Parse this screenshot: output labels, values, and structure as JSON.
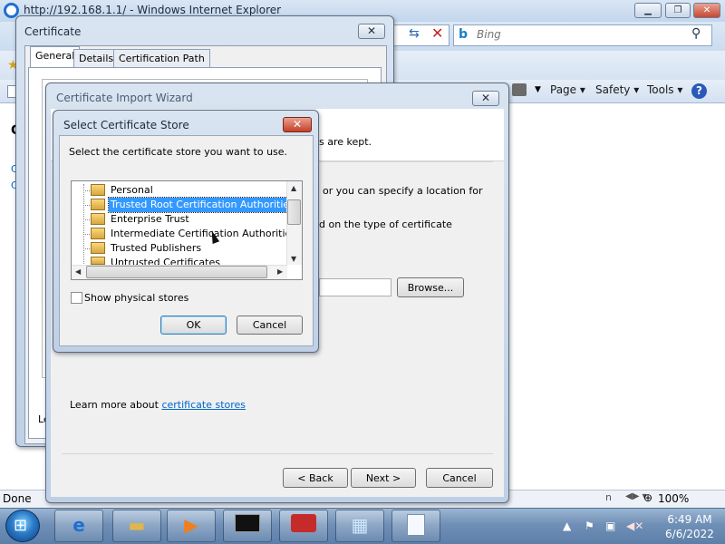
{
  "ie": {
    "title": "http://192.168.1.1/ - Windows Internet Explorer",
    "search_placeholder": "Bing",
    "commands": [
      "Page ▾",
      "Safety ▾",
      "Tools ▾"
    ],
    "status": "Done",
    "zoom": "100%"
  },
  "cert": {
    "title": "Certificate",
    "tabs": [
      "General",
      "Details",
      "Certification Path"
    ],
    "fragment": "Le"
  },
  "wizard": {
    "title": "Certificate Import Wizard",
    "line1": "s are kept.",
    "line2": "or you can specify a location for",
    "line3": "d on the type of certificate",
    "browse": "Browse...",
    "learn_prefix": "Learn more about ",
    "learn_link": "certificate stores",
    "back": "< Back",
    "next": "Next >",
    "cancel": "Cancel"
  },
  "store": {
    "title": "Select Certificate Store",
    "prompt": "Select the certificate store you want to use.",
    "items": [
      "Personal",
      "Trusted Root Certification Authorities",
      "Enterprise Trust",
      "Intermediate Certification Authorities",
      "Trusted Publishers",
      "Untrusted Certificates"
    ],
    "selected_index": 1,
    "show_physical": "Show physical stores",
    "ok": "OK",
    "cancel": "Cancel"
  },
  "taskbar": {
    "time": "6:49 AM",
    "date": "6/6/2022"
  },
  "icons": {
    "start": "windows-flag-icon",
    "ie": "internet-explorer-icon",
    "explorer": "folder-icon",
    "media": "media-player-icon",
    "cmd": "command-prompt-icon",
    "toolbox": "toolbox-icon",
    "network": "network-icon",
    "notepad": "document-icon"
  }
}
